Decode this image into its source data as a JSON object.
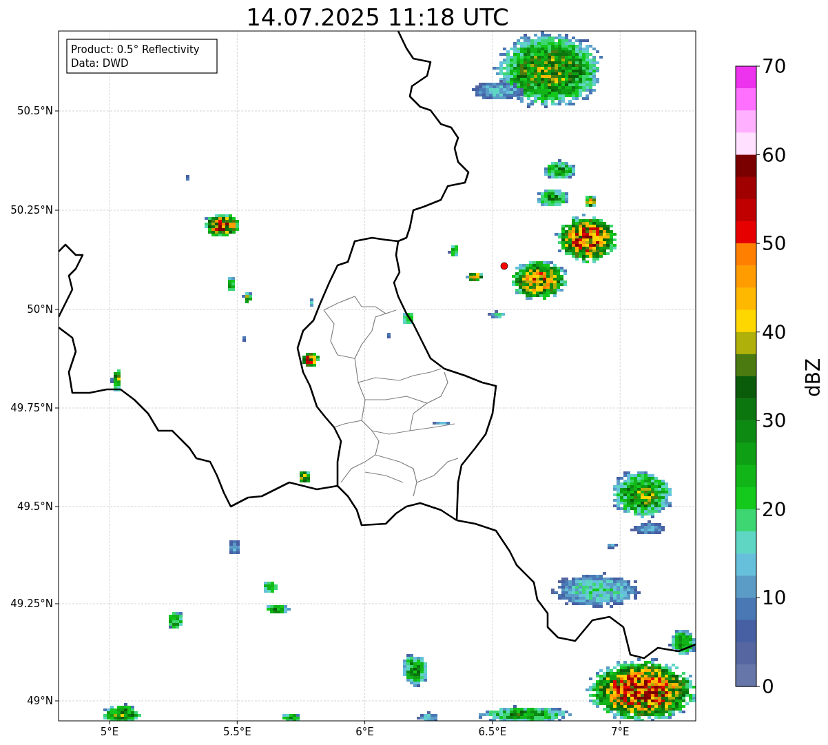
{
  "title": "14.07.2025 11:18 UTC",
  "info_box": [
    "Product: 0.5° Reflectivity",
    "Data: DWD"
  ],
  "map": {
    "x_ticks": [
      "5°E",
      "5.5°E",
      "6°E",
      "6.5°E",
      "7°E"
    ],
    "y_ticks": [
      "50.5°N",
      "50.25°N",
      "50°N",
      "49.75°N",
      "49.5°N",
      "49.25°N",
      "49°N"
    ]
  },
  "colorbar": {
    "label": "dBZ",
    "ticks": [
      "70",
      "60",
      "50",
      "40",
      "30",
      "20",
      "10",
      "0"
    ],
    "colors": [
      {
        "color": "#ee33ee"
      },
      {
        "color": "#ff70ff"
      },
      {
        "color": "#ffb0ff"
      },
      {
        "color": "#ffe0ff"
      },
      {
        "color": "#7a0000"
      },
      {
        "color": "#a00000"
      },
      {
        "color": "#c00000"
      },
      {
        "color": "#e60000"
      },
      {
        "color": "#ff8000"
      },
      {
        "color": "#ff9c00"
      },
      {
        "color": "#ffb800"
      },
      {
        "color": "#ffd700"
      },
      {
        "color": "#b0b00a"
      },
      {
        "color": "#4a7a10"
      },
      {
        "color": "#0a5c0b"
      },
      {
        "color": "#0b760e"
      },
      {
        "color": "#0d8a12"
      },
      {
        "color": "#0f9f14"
      },
      {
        "color": "#12b518"
      },
      {
        "color": "#14c81c"
      },
      {
        "color": "#3dd672"
      },
      {
        "color": "#5fd6c4"
      },
      {
        "color": "#66c0db"
      },
      {
        "color": "#5b9cc6"
      },
      {
        "color": "#4a78b4"
      },
      {
        "color": "#4660a3"
      },
      {
        "color": "#5566a0"
      },
      {
        "color": "#6776a8"
      }
    ]
  }
}
